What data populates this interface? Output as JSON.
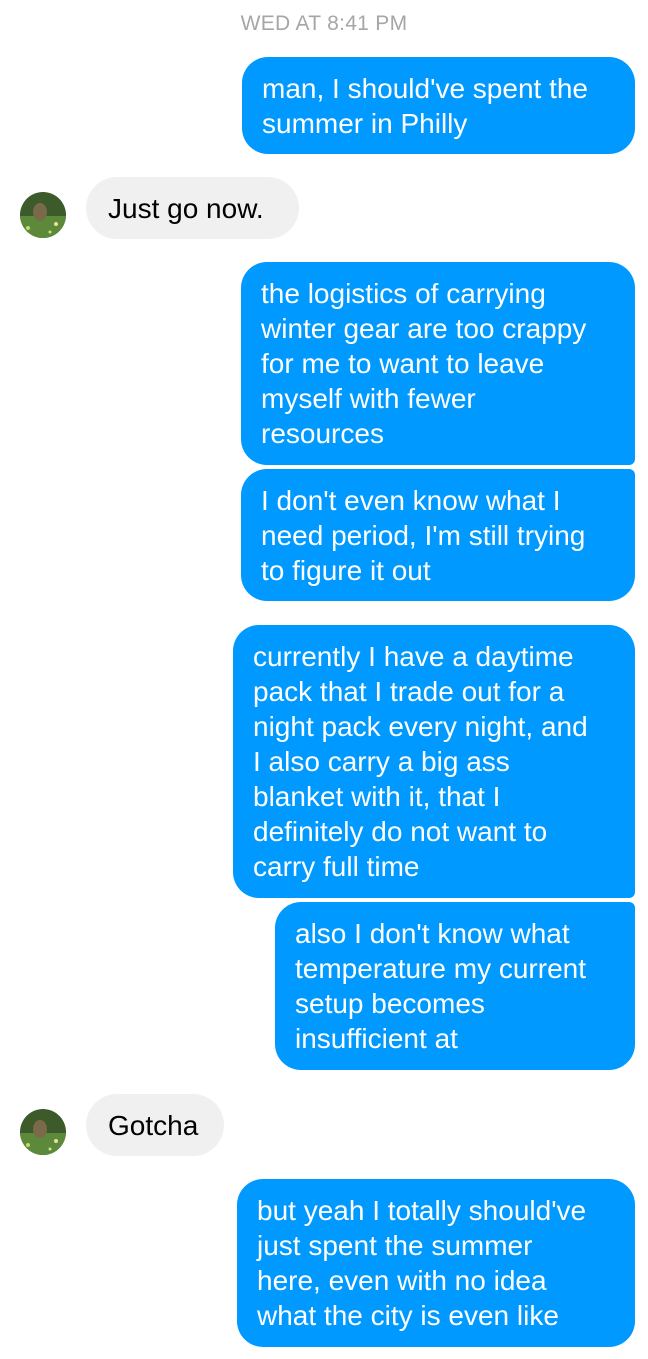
{
  "conversation": {
    "timestamp": "WED AT 8:41 PM",
    "messages": [
      {
        "sender": "me",
        "text": "man, I should've spent the\nsummer in Philly"
      },
      {
        "sender": "them",
        "text": "Just go now."
      },
      {
        "sender": "me",
        "text": "the logistics of carrying\nwinter gear are too crappy\nfor me to want to leave\nmyself with fewer\nresources"
      },
      {
        "sender": "me",
        "text": "I don't even know what I\nneed period, I'm still trying\nto figure it out"
      },
      {
        "sender": "me",
        "text": "currently I have a daytime\npack that I trade out for a\nnight pack every night, and\nI also carry a big ass\nblanket with it, that I\ndefinitely do not want to\ncarry full time"
      },
      {
        "sender": "me",
        "text": "also I don't know what\ntemperature my current\nsetup becomes\ninsufficient at"
      },
      {
        "sender": "them",
        "text": "Gotcha"
      },
      {
        "sender": "me",
        "text": "but yeah I totally should've\njust spent the summer\nhere, even with no idea\nwhat the city is even like"
      }
    ]
  },
  "colors": {
    "outgoing_bubble": "#0099ff",
    "incoming_bubble": "#f1f0f0",
    "timestamp_text": "#a6a6a6"
  },
  "icons": {
    "avatar": "contact-avatar-photo"
  }
}
